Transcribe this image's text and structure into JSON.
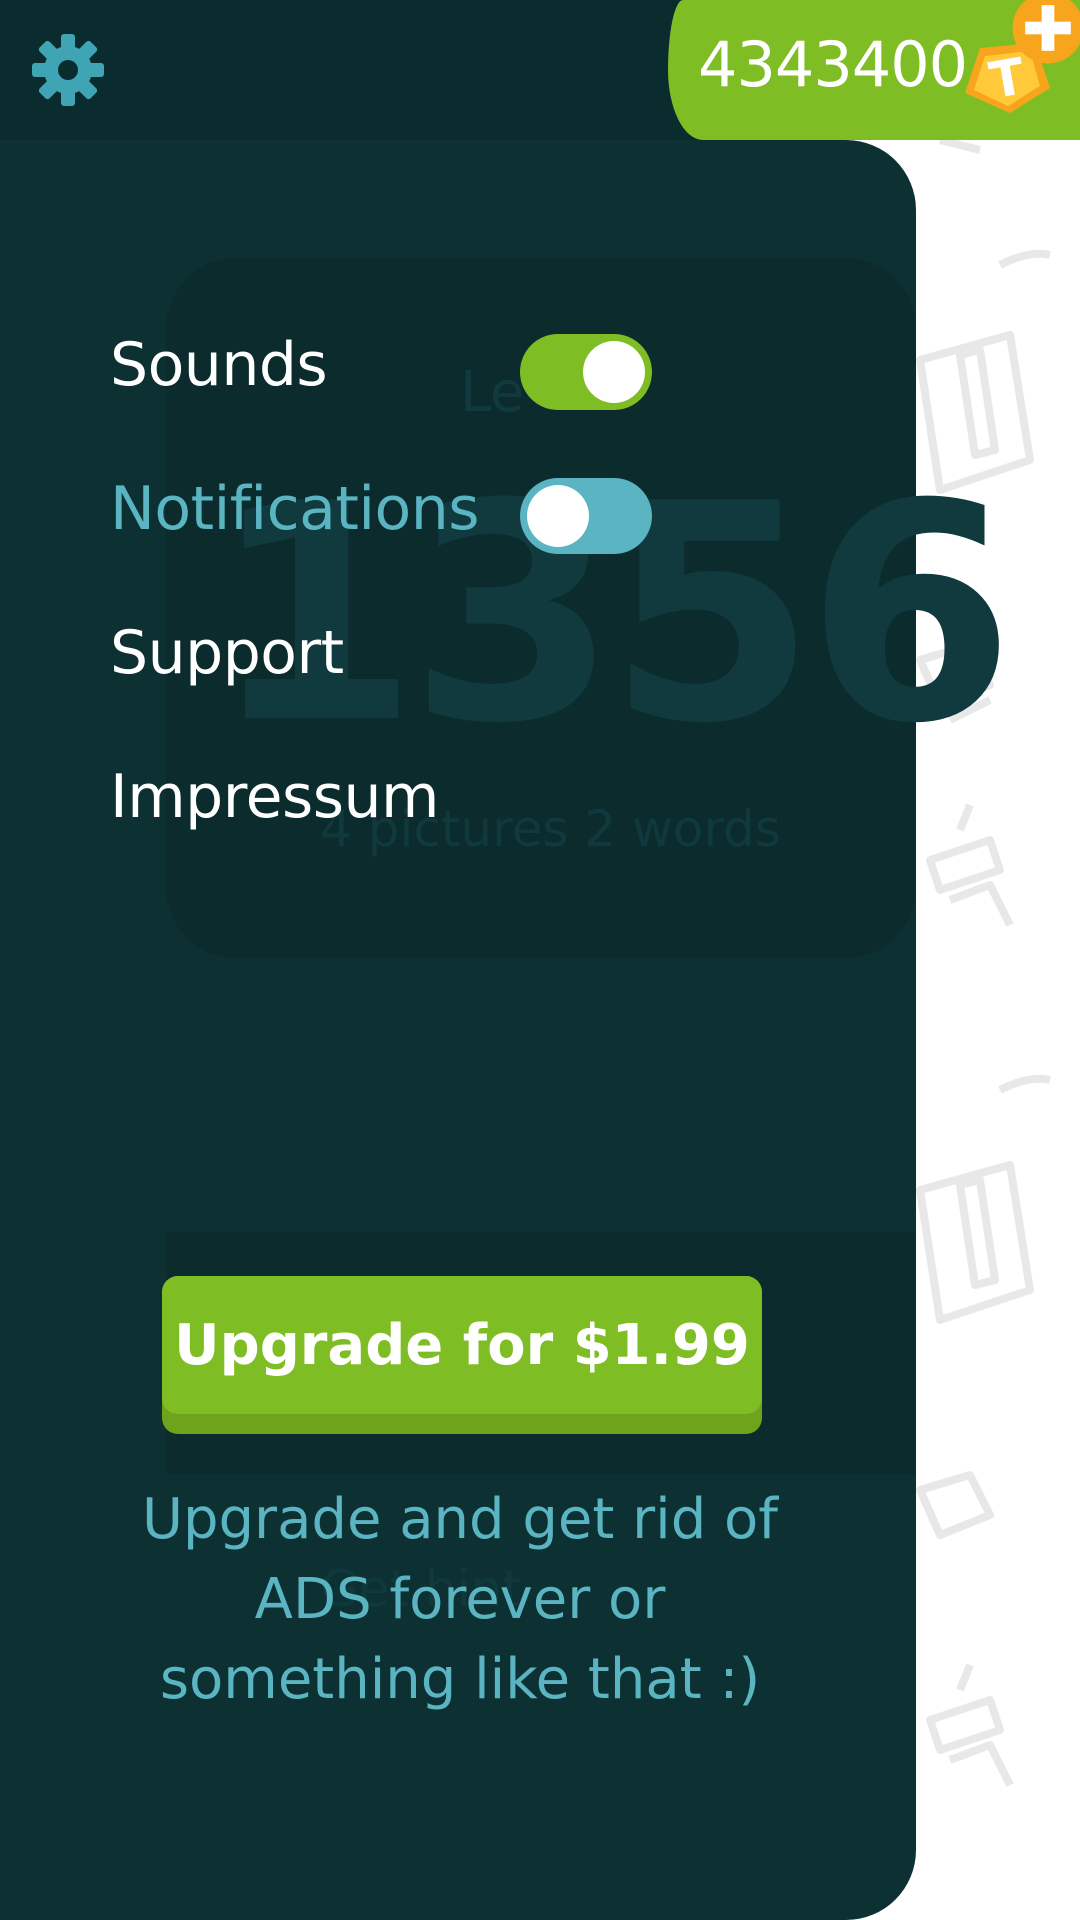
{
  "header": {
    "settings_icon": "gear-icon",
    "coin_balance": "4343400",
    "coin_icon": "coin-t-icon",
    "add_coins_icon": "plus-icon"
  },
  "background_level": {
    "word": "Le",
    "number": "1356",
    "subtitle": "4 pictures 2 words",
    "bottom_text": "Get hint"
  },
  "settings": {
    "items": [
      {
        "label": "Sounds",
        "toggle": true
      },
      {
        "label": "Notifications",
        "toggle": false
      },
      {
        "label": "Support"
      },
      {
        "label": "Impressum"
      }
    ]
  },
  "upgrade": {
    "button_label": "Upgrade for $1.99",
    "note": "Upgrade and get rid of ADS forever or something like that :)"
  },
  "colors": {
    "topbar": "#0a2c2f",
    "panel": "#0d3033",
    "accent_green": "#7fbd24",
    "accent_teal": "#5ab4c1",
    "coin_orange": "#f7a51c"
  }
}
